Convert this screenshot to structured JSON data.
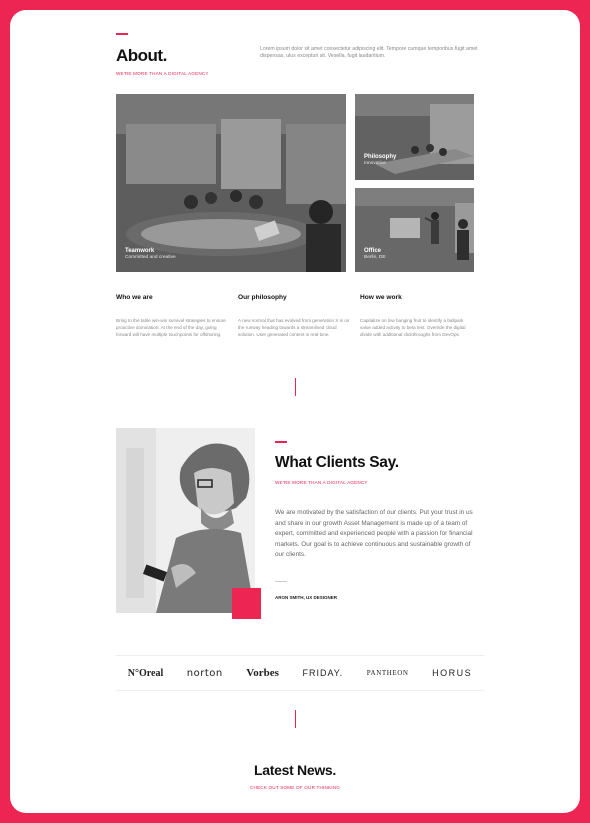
{
  "colors": {
    "accent": "#ed2553",
    "text_dark": "#111111",
    "text_muted": "#888888"
  },
  "about": {
    "title": "About.",
    "subtitle": "WE'RE MORE THAN A DIGITAL AGENCY",
    "intro": "Lorem ipsum dolor sit amet consectetur adipiscing elit. Tempore cumque temporibus fugit amet dispensas, ulus excepturi sit. Vesella, fugit laudantium."
  },
  "photos": [
    {
      "title": "Teamwork",
      "subtitle": "Committed and creative"
    },
    {
      "title": "Philosophy",
      "subtitle": "Innovative"
    },
    {
      "title": "Office",
      "subtitle": "Berlin, DE"
    }
  ],
  "columns": [
    {
      "heading": "Who we are",
      "text": "Bring to the table win-win survival strategies to ensure proactive domination. At the end of the day, going forward will have multiple touchpoints for offshoring."
    },
    {
      "heading": "Our philosophy",
      "text": "A new normal that has evolved from generation X is on the runway heading towards a streamlined cloud solution. User generated content in real-time."
    },
    {
      "heading": "How we work",
      "text": "Capitalize on low hanging fruit to identify a ballpark value added activity to beta test. Override the digital divide with additional clickthroughs from DevOps."
    }
  ],
  "clients": {
    "title": "What Clients Say.",
    "subtitle": "WE'RE MORE THAN A DIGITAL AGENCY",
    "text": "We are motivated by the satisfaction of our clients. Put your trust in us and share in our growth Asset Management is made up of a team of expert, committed and experienced people with a passion for financial markets. Our goal is to achieve continuous and sustainable growth of our clients.",
    "author": "ARON SMITH, UX DESIGNER"
  },
  "logos": [
    "N°Oreal",
    "norton",
    "Vorbes",
    "FRIDAY.",
    "PANTHEON",
    "HORUS"
  ],
  "news": {
    "title": "Latest News.",
    "subtitle": "CHECK OUT SOME OF OUR THINKING"
  }
}
